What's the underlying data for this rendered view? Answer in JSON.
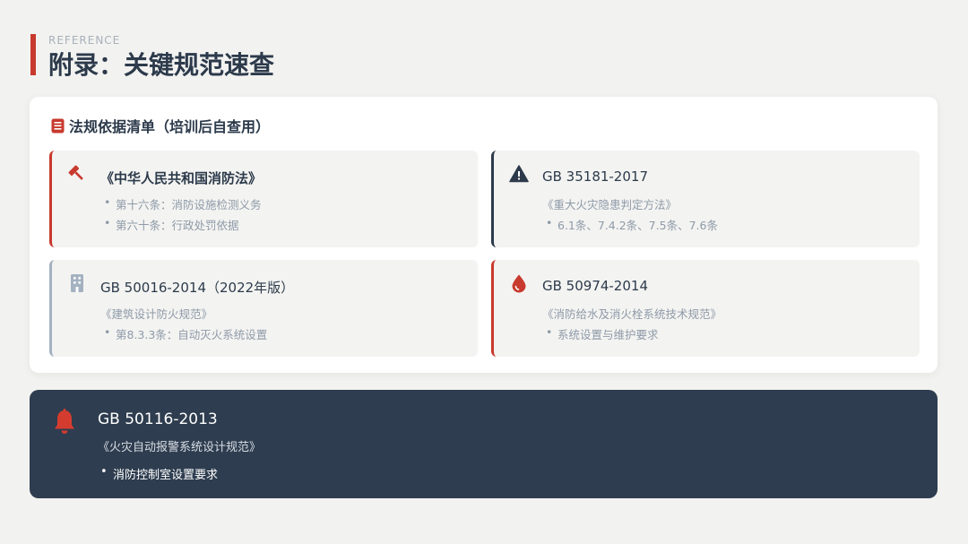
{
  "header": {
    "eyebrow": "REFERENCE",
    "title": "附录：关键规范速查"
  },
  "panel": {
    "icon": "book-icon",
    "title": "法规依据清单（培训后自查用）",
    "cards": [
      {
        "icon": "gavel-icon",
        "accent": "#c83a2e",
        "title": "《中华人民共和国消防法》",
        "bullets": [
          "第十六条：消防设施检测义务",
          "第六十条：行政处罚依据"
        ]
      },
      {
        "icon": "warning-icon",
        "accent": "#2c3a4b",
        "title": "GB 35181-2017",
        "subtitle": "《重大火灾隐患判定方法》",
        "bullets": [
          "6.1条、7.4.2条、7.5条、7.6条"
        ]
      },
      {
        "icon": "building-icon",
        "accent": "#a4b1c0",
        "title": "GB 50016-2014（2022年版）",
        "subtitle": "《建筑设计防火规范》",
        "bullets": [
          "第8.3.3条：自动灭火系统设置"
        ]
      },
      {
        "icon": "water-drop-icon",
        "accent": "#c83a2e",
        "title": "GB 50974-2014",
        "subtitle": "《消防给水及消火栓系统技术规范》",
        "bullets": [
          "系统设置与维护要求"
        ]
      }
    ]
  },
  "highlight": {
    "icon": "bell-icon",
    "title": "GB 50116-2013",
    "subtitle": "《火灾自动报警系统设计规范》",
    "bullet": "消防控制室设置要求"
  },
  "colors": {
    "accent_red": "#c83a2e",
    "navy": "#2e3d4f",
    "background": "#f2f2f0"
  }
}
